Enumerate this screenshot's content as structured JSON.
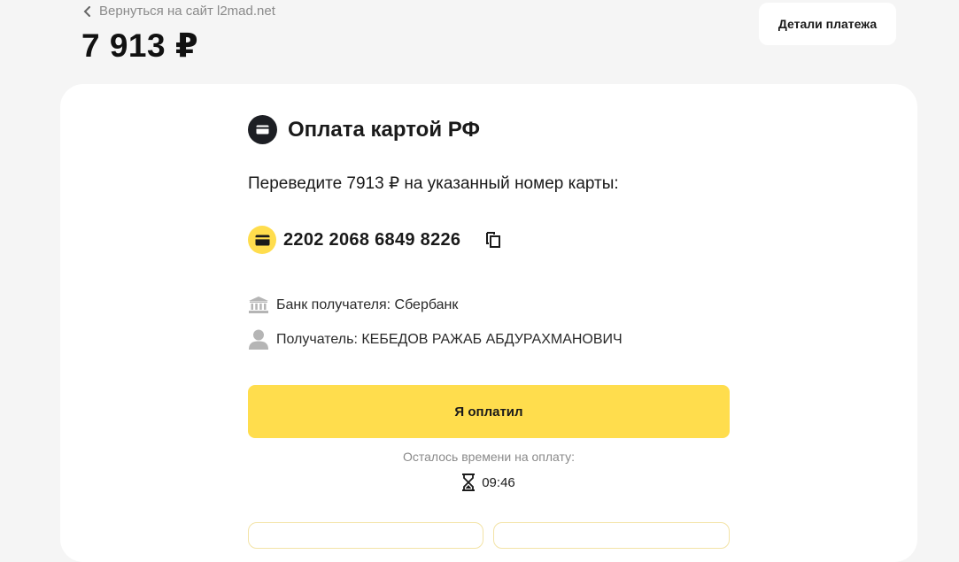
{
  "header": {
    "back_label": "Вернуться на сайт l2mad.net",
    "amount": "7 913 ₽",
    "details_label": "Детали платежа"
  },
  "payment": {
    "title": "Оплата картой РФ",
    "instruction": "Переведите 7913 ₽ на указанный номер карты:",
    "card_number": "2202 2068 6849 8226",
    "bank": "Банк получателя: Сбербанк",
    "recipient": "Получатель: КЕБЕДОВ РАЖАБ АБДУРАХМАНОВИЧ",
    "paid_button": "Я оплатил",
    "time_left_label": "Осталось времени на оплату:",
    "time_left": "09:46"
  },
  "icons": {
    "back": "chevron-left-icon",
    "heading": "card-icon",
    "card": "card-icon",
    "copy": "copy-icon",
    "bank": "bank-icon",
    "recipient": "user-icon",
    "timer": "hourglass-icon"
  },
  "colors": {
    "accent": "#ffdd4d",
    "background": "#f5f5f5",
    "panel": "#ffffff",
    "dark_icon": "#1d1f24",
    "muted_text": "#8a8a8a"
  }
}
